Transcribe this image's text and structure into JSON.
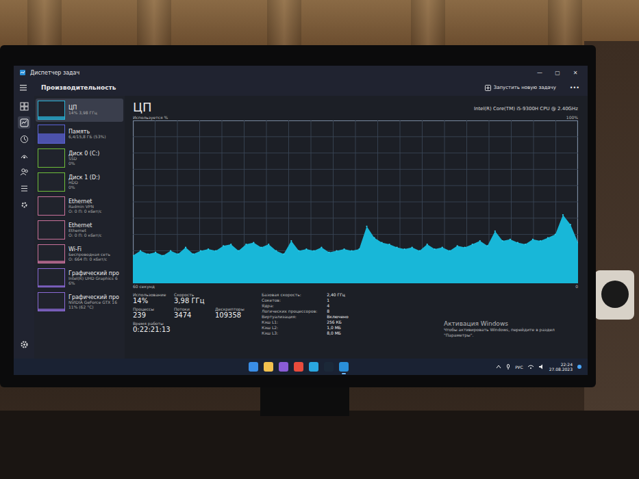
{
  "window": {
    "title": "Диспетчер задач",
    "controls": [
      "—",
      "▢",
      "✕"
    ]
  },
  "header": {
    "title": "Производительность",
    "new_task": "Запустить новую задачу",
    "more": "•••"
  },
  "nav": [
    {
      "selected": false
    },
    {
      "selected": true
    },
    {
      "selected": false
    },
    {
      "selected": false
    },
    {
      "selected": false
    },
    {
      "selected": false
    },
    {
      "selected": false
    },
    {
      "selected": false
    }
  ],
  "sidebar": {
    "items": [
      {
        "label": "ЦП",
        "sub": "14% 3,98 ГГц",
        "detail": "",
        "selected": true,
        "level": 0.14,
        "color": "#2ab4d9"
      },
      {
        "label": "Память",
        "sub": "6,4/15,8 ГБ (53%)",
        "detail": "",
        "selected": false,
        "level": 0.53,
        "color": "#5b63d6"
      },
      {
        "label": "Диск 0 (C:)",
        "sub": "SSD",
        "detail": "0%",
        "selected": false,
        "level": 0.0,
        "color": "#6fbf3a"
      },
      {
        "label": "Диск 1 (D:)",
        "sub": "HDD",
        "detail": "0%",
        "selected": false,
        "level": 0.0,
        "color": "#6fbf3a"
      },
      {
        "label": "Ethernet",
        "sub": "Radmin VPN",
        "detail": "О: 0 П: 0 кбит/с",
        "selected": false,
        "level": 0.0,
        "color": "#c9729b"
      },
      {
        "label": "Ethernet",
        "sub": "Ethernet",
        "detail": "О: 0 П: 0 кбит/с",
        "selected": false,
        "level": 0.0,
        "color": "#c9729b"
      },
      {
        "label": "Wi-Fi",
        "sub": "Беспроводная сеть",
        "detail": "О: 664 П: 0 кбит/с",
        "selected": false,
        "level": 0.1,
        "color": "#c9729b"
      },
      {
        "label": "Графический про",
        "sub": "Intel(R) UHD Graphics 6",
        "detail": "6%",
        "selected": false,
        "level": 0.06,
        "color": "#8a6ad6"
      },
      {
        "label": "Графический про",
        "sub": "NVIDIA GeForce GTX 16",
        "detail": "11% (62 °C)",
        "selected": false,
        "level": 0.11,
        "color": "#8a6ad6"
      }
    ]
  },
  "cpu": {
    "title": "ЦП",
    "model": "Intel(R) Core(TM) i5-9300H CPU @ 2.40GHz",
    "y_label": "Используется %",
    "y_max": "100%",
    "x_label": "60 секунд",
    "x_min": "0",
    "series": [
      17,
      20,
      18,
      19,
      17,
      20,
      18,
      22,
      18,
      20,
      21,
      20,
      23,
      24,
      20,
      24,
      25,
      22,
      24,
      20,
      18,
      26,
      20,
      21,
      20,
      22,
      19,
      20,
      21,
      20,
      21,
      35,
      28,
      25,
      24,
      22,
      21,
      22,
      20,
      24,
      21,
      22,
      20,
      23,
      22,
      24,
      26,
      23,
      32,
      26,
      27,
      25,
      24,
      27,
      26,
      28,
      30,
      42,
      36,
      25
    ]
  },
  "stats": [
    [
      {
        "label": "Использование",
        "value": "14%"
      },
      {
        "label": "Скорость",
        "value": "3,98 ГГц"
      }
    ],
    [
      {
        "label": "Процессы",
        "value": "239"
      },
      {
        "label": "Потоки",
        "value": "3474"
      },
      {
        "label": "Дескрипторы",
        "value": "109358"
      }
    ],
    [
      {
        "label": "Время работы",
        "value": "0:22:21:13"
      }
    ]
  ],
  "details": [
    {
      "label": "Базовая скорость:",
      "value": "2,40 ГГц"
    },
    {
      "label": "Сокетов:",
      "value": "1"
    },
    {
      "label": "Ядра:",
      "value": "4"
    },
    {
      "label": "Логических процессоров:",
      "value": "8"
    },
    {
      "label": "Виртуализация:",
      "value": "Включено"
    },
    {
      "label": "Кэш L1:",
      "value": "256 КБ"
    },
    {
      "label": "Кэш L2:",
      "value": "1,0 МБ"
    },
    {
      "label": "Кэш L3:",
      "value": "8,0 МБ"
    }
  ],
  "watermark": {
    "title": "Активация Windows",
    "text": "Чтобы активировать Windows, перейдите в раздел \"Параметры\"."
  },
  "taskbar": {
    "apps": [
      {
        "active": false
      },
      {
        "active": false
      },
      {
        "active": false
      },
      {
        "active": false
      },
      {
        "active": false
      },
      {
        "active": false
      },
      {
        "active": true
      }
    ],
    "lang": "РУС",
    "time": "22:24",
    "date": "27.08.2023"
  }
}
